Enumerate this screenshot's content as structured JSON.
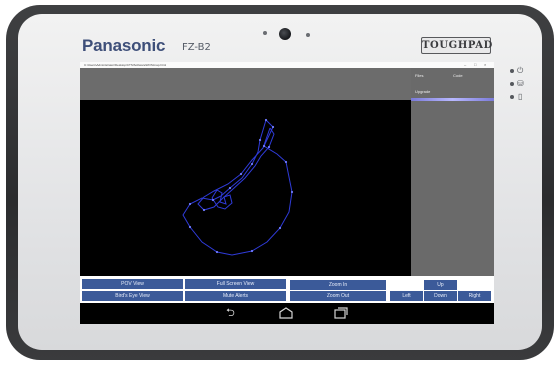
{
  "device": {
    "brand": "Panasonic",
    "model": "FZ-B2",
    "series_logo": "TOUGHPAD",
    "side_icons": [
      "power-icon",
      "storage-icon",
      "battery-icon"
    ]
  },
  "window": {
    "title": "C:\\Users\\Administrator\\Desktop\\CTS\\Software\\ROS\\map.html",
    "controls": [
      "–",
      "□",
      "×"
    ]
  },
  "menu": {
    "files": "Files",
    "code": "Code",
    "upgrade": "Upgrade"
  },
  "controls": {
    "pov_view": "POV View",
    "full_screen_view": "Full Screen View",
    "birds_eye_view": "Bird's Eye View",
    "mute_alerts": "Mute Alerts",
    "zoom_in": "Zoom In",
    "zoom_out": "Zoom Out",
    "up": "Up",
    "left": "Left",
    "down": "Down",
    "right": "Right"
  },
  "android_nav": [
    "back-icon",
    "home-icon",
    "recents-icon"
  ],
  "colors": {
    "button_blue": "#3b5a99",
    "path_blue": "#2f3bd9",
    "panel_gray": "#6a6a6a",
    "brand_blue": "#3e4f79"
  }
}
